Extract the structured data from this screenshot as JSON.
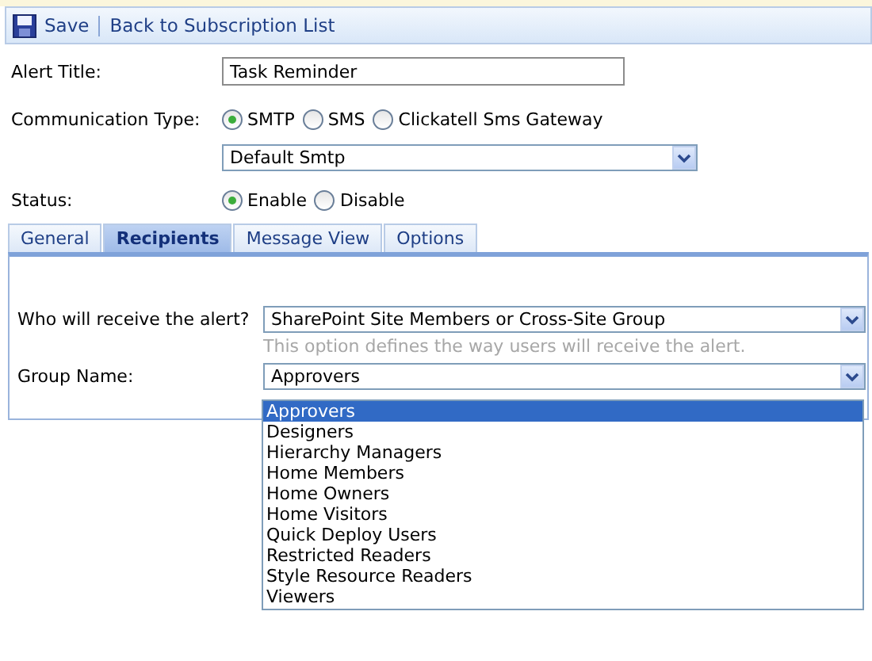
{
  "toolbar": {
    "items": [
      {
        "kind": "save",
        "label": "Save"
      },
      {
        "kind": "link",
        "label": "Back to Subscription List"
      }
    ]
  },
  "alert_title": {
    "label": "Alert Title:",
    "value": "Task Reminder"
  },
  "communication_type": {
    "label": "Communication Type:",
    "options": [
      {
        "label": "SMTP",
        "selected": true
      },
      {
        "label": "SMS",
        "selected": false
      },
      {
        "label": "Clickatell Sms Gateway",
        "selected": false
      }
    ],
    "server": "Default Smtp"
  },
  "status": {
    "label": "Status:",
    "options": [
      {
        "label": "Enable",
        "selected": true
      },
      {
        "label": "Disable",
        "selected": false
      }
    ]
  },
  "tabs": [
    {
      "label": "General",
      "selected": false
    },
    {
      "label": "Recipients",
      "selected": true
    },
    {
      "label": "Message View",
      "selected": false
    },
    {
      "label": "Options",
      "selected": false
    }
  ],
  "recipients": {
    "who_label": "Who will receive the alert?",
    "who_value": "SharePoint Site Members or Cross-Site Group",
    "hint": "This option defines the way users will receive the alert.",
    "group_label": "Group Name:",
    "group_value": "Approvers",
    "group_options": [
      {
        "label": "Approvers",
        "selected": true
      },
      {
        "label": "Designers",
        "selected": false
      },
      {
        "label": "Hierarchy Managers",
        "selected": false
      },
      {
        "label": "Home Members",
        "selected": false
      },
      {
        "label": "Home Owners",
        "selected": false
      },
      {
        "label": "Home Visitors",
        "selected": false
      },
      {
        "label": "Quick Deploy Users",
        "selected": false
      },
      {
        "label": "Restricted Readers",
        "selected": false
      },
      {
        "label": "Style Resource Readers",
        "selected": false
      },
      {
        "label": "Viewers",
        "selected": false
      }
    ]
  }
}
